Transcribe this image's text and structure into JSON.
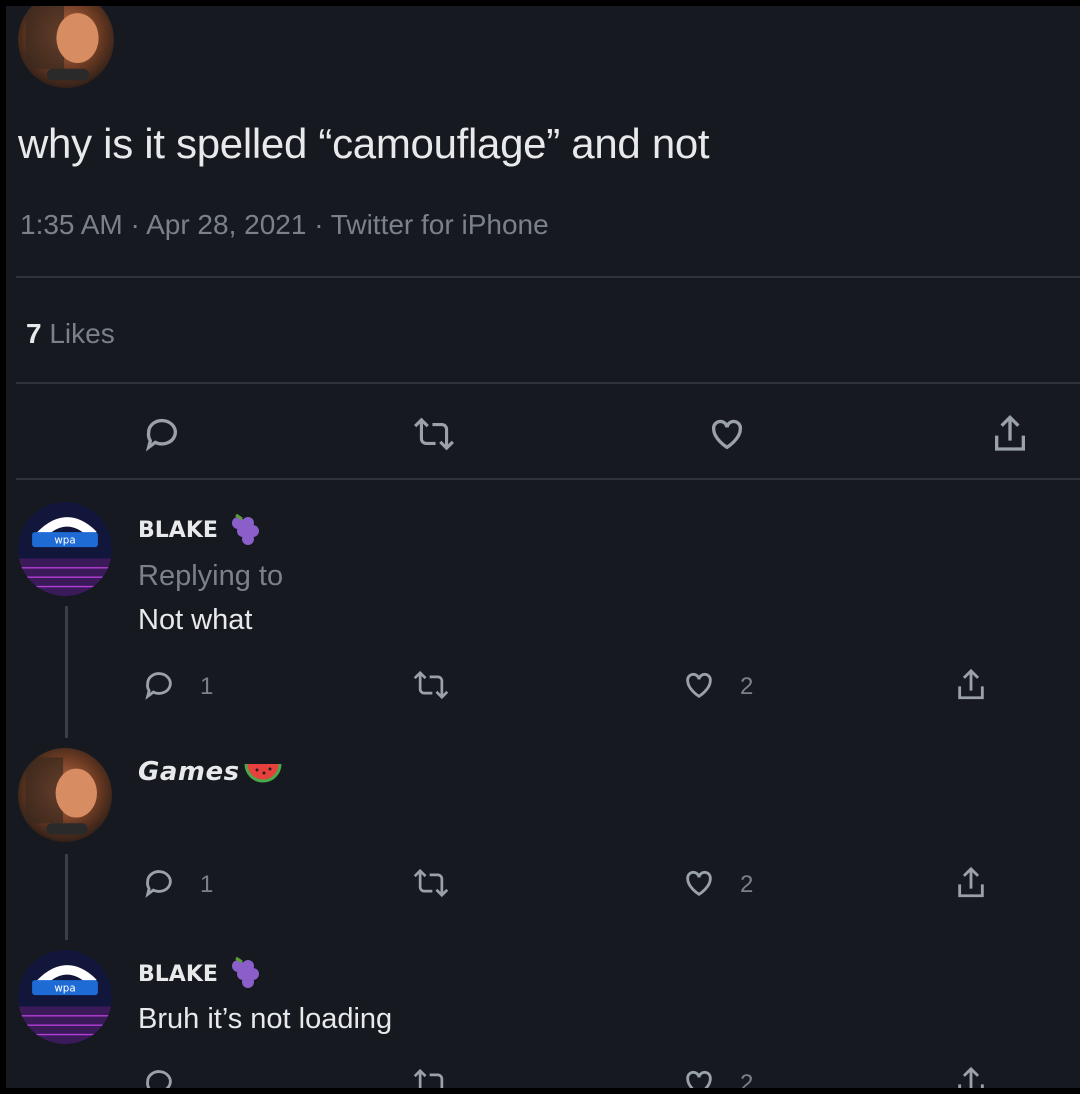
{
  "main_tweet": {
    "avatar_icon": "games-avatar-icon",
    "text": "why is it spelled “camouflage” and not",
    "meta": "1:35 AM · Apr 28, 2021 · Twitter for iPhone",
    "likes_count": "7",
    "likes_label": "Likes",
    "actions": [
      "reply-icon",
      "retweet-icon",
      "like-icon",
      "share-icon"
    ]
  },
  "replies": [
    {
      "author": "BLAKE",
      "emoji": "grapes-emoji",
      "replying_to": "Replying to",
      "text": "Not what",
      "reply_count": "1",
      "like_count": "2"
    },
    {
      "author": "Games",
      "emoji": "watermelon-emoji",
      "text": "",
      "reply_count": "1",
      "like_count": "2"
    },
    {
      "author": "BLAKE",
      "emoji": "grapes-emoji",
      "text": "Bruh it’s not loading",
      "like_count": "2"
    }
  ],
  "colors": {
    "background": "#16191f",
    "text": "#e7e9ea",
    "muted": "#7a8189",
    "divider": "#2e333a"
  }
}
